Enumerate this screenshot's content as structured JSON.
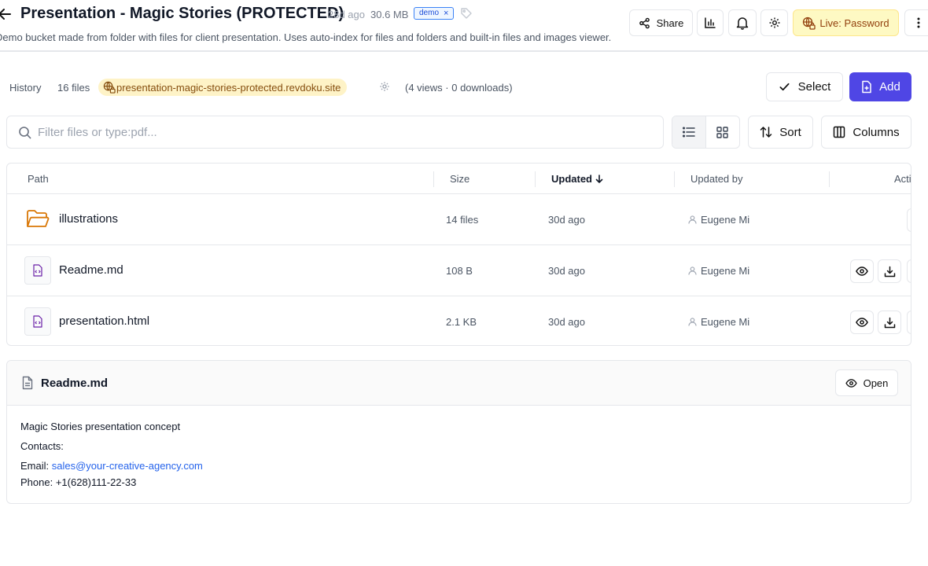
{
  "header": {
    "title": "Presentation - Magic Stories (PROTECTED)",
    "age": "28d ago",
    "size": "30.6 MB",
    "tag": "demo",
    "tag_remove": "×",
    "description": "Demo bucket made from folder with files for client presentation. Uses auto-index for files and folders and built-in files and images viewer.",
    "share_label": "Share",
    "live_label": "Live: Password",
    "icons": [
      "arrow-left-icon",
      "tag-icon",
      "share-icon",
      "bar-chart-icon",
      "bell-icon",
      "gear-icon",
      "live-password-icon",
      "more-vertical-icon"
    ]
  },
  "info": {
    "history_label": "History",
    "files_count": "16 files",
    "site_url": "presentation-magic-stories-protected.revdoku.site",
    "stats": "(4 views · 0 downloads)",
    "select_label": "Select",
    "add_label": "Add"
  },
  "filter": {
    "placeholder": "Filter files or type:pdf...",
    "value": "",
    "sort_label": "Sort",
    "columns_label": "Columns",
    "view_mode": "list"
  },
  "table": {
    "columns": [
      "Path",
      "Size",
      "Updated",
      "Updated by",
      "Actions"
    ],
    "sorted_by": "Updated",
    "sort_direction": "descending",
    "rows": [
      {
        "name": "illustrations",
        "type": "folder",
        "size": "14 files",
        "updated": "30d ago",
        "updated_by": "Eugene Mi"
      },
      {
        "name": "Readme.md",
        "type": "file",
        "size": "108 B",
        "updated": "30d ago",
        "updated_by": "Eugene Mi"
      },
      {
        "name": "presentation.html",
        "type": "file",
        "size": "2.1 KB",
        "updated": "30d ago",
        "updated_by": "Eugene Mi"
      }
    ]
  },
  "readme": {
    "title": "Readme.md",
    "open_label": "Open",
    "lines": {
      "concept": "Magic Stories presentation concept",
      "contacts": "Contacts:",
      "email_label": "Email: ",
      "email": "sales@your-creative-agency.com",
      "phone": "Phone: +1(628)111-22-33"
    }
  },
  "colors": {
    "accent": "#4f46e5",
    "live_badge_bg": "#fef9c3",
    "site_badge_bg": "#fef3c7",
    "folder": "#d97706",
    "link": "#2563eb"
  }
}
